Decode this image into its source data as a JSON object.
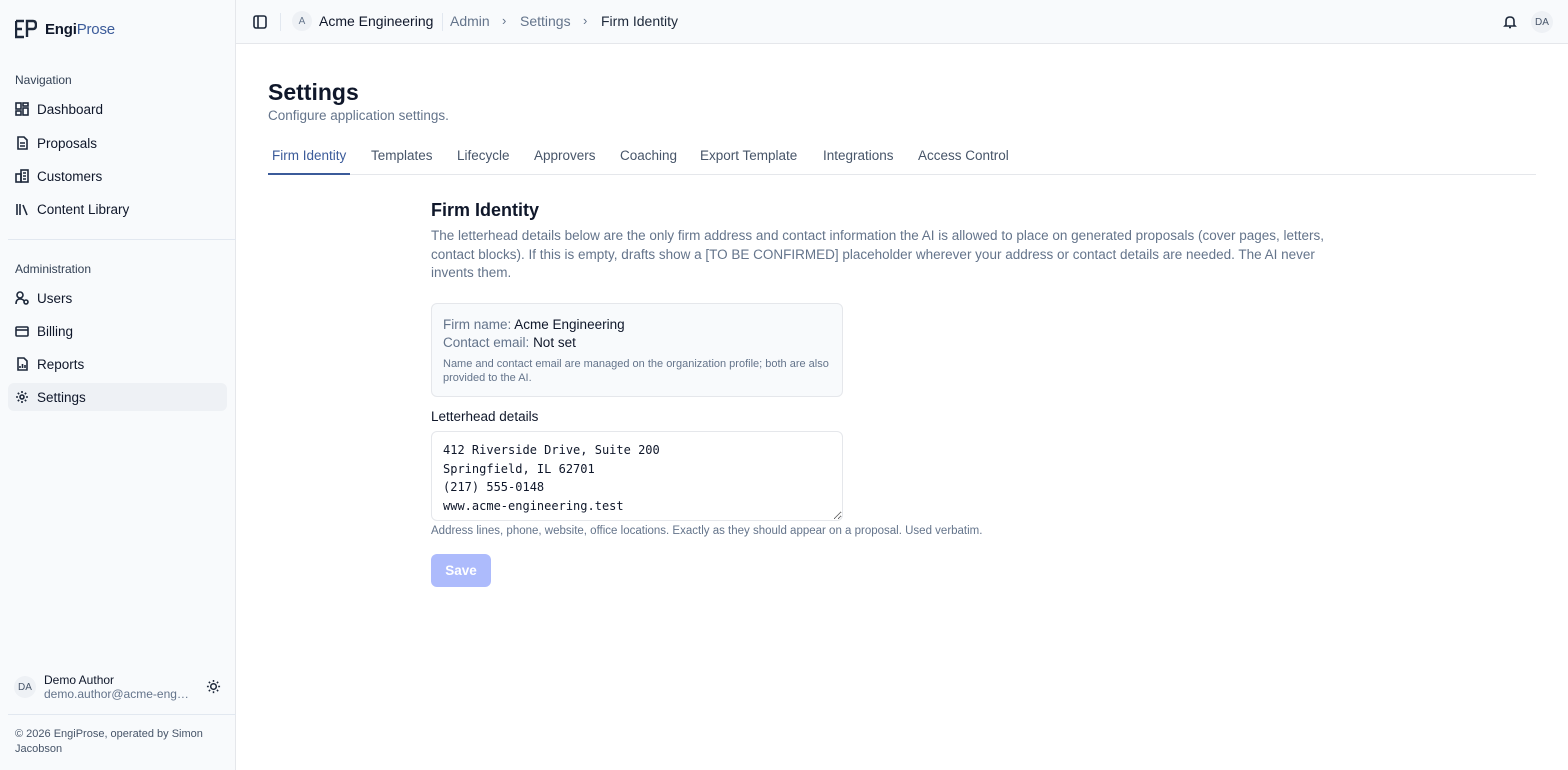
{
  "brand": {
    "name_part1": "Engi",
    "name_part2": "Prose"
  },
  "sidebar": {
    "nav_section_label": "Navigation",
    "nav_items": [
      {
        "label": "Dashboard",
        "icon": "dashboard-icon"
      },
      {
        "label": "Proposals",
        "icon": "document-icon"
      },
      {
        "label": "Customers",
        "icon": "building-icon"
      },
      {
        "label": "Content Library",
        "icon": "library-icon"
      }
    ],
    "admin_section_label": "Administration",
    "admin_items": [
      {
        "label": "Users",
        "icon": "users-icon"
      },
      {
        "label": "Billing",
        "icon": "credit-card-icon"
      },
      {
        "label": "Reports",
        "icon": "report-icon"
      },
      {
        "label": "Settings",
        "icon": "gear-icon",
        "active": true
      }
    ],
    "user": {
      "initials": "DA",
      "name": "Demo Author",
      "email": "demo.author@acme-engineering.test"
    },
    "footer": "© 2026 EngiProse, operated by Simon Jacobson"
  },
  "topbar": {
    "org_initial": "A",
    "org_name": "Acme Engineering",
    "breadcrumbs": [
      "Admin",
      "Settings",
      "Firm Identity"
    ],
    "separator": "›",
    "user_initials": "DA"
  },
  "page": {
    "title": "Settings",
    "subtitle": "Configure application settings.",
    "tabs": [
      "Firm Identity",
      "Templates",
      "Lifecycle",
      "Approvers",
      "Coaching",
      "Export Template",
      "Integrations",
      "Access Control"
    ],
    "active_tab": "Firm Identity"
  },
  "firm_identity": {
    "title": "Firm Identity",
    "description": "The letterhead details below are the only firm address and contact information the AI is allowed to place on generated proposals (cover pages, letters, contact blocks). If this is empty, drafts show a [TO BE CONFIRMED] placeholder wherever your address or contact details are needed. The AI never invents them.",
    "firm_name_key": "Firm name:",
    "firm_name_value": "Acme Engineering",
    "contact_email_key": "Contact email:",
    "contact_email_value": "Not set",
    "profile_note": "Name and contact email are managed on the organization profile; both are also provided to the AI.",
    "letterhead_label": "Letterhead details",
    "letterhead_value": "412 Riverside Drive, Suite 200\nSpringfield, IL 62701\n(217) 555-0148\nwww.acme-engineering.test",
    "letterhead_help": "Address lines, phone, website, office locations. Exactly as they should appear on a proposal. Used verbatim.",
    "save_label": "Save"
  },
  "colors": {
    "accent": "#3b5b9a",
    "save_disabled": "#a5b4fc",
    "sidebar_bg": "#f8fafc"
  }
}
